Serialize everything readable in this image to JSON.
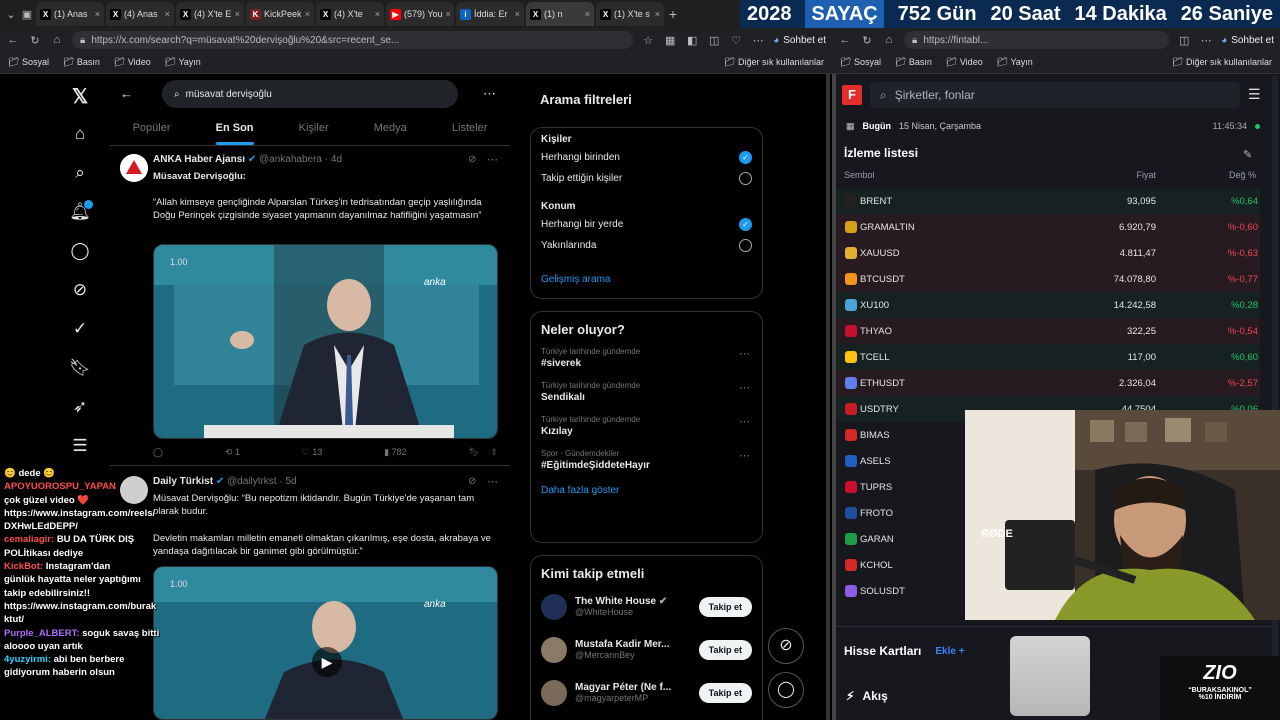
{
  "browser": {
    "tabs": [
      {
        "label": "(1) Anas",
        "fav": "X",
        "fav_color": "#000000"
      },
      {
        "label": "(4) Anas",
        "fav": "X",
        "fav_color": "#000000"
      },
      {
        "label": "(4) X'te E",
        "fav": "X",
        "fav_color": "#000000"
      },
      {
        "label": "KickPeek",
        "fav": "K",
        "fav_color": "#7a1f1f"
      },
      {
        "label": "(4) X'te",
        "fav": "X",
        "fav_color": "#000000"
      },
      {
        "label": "(579) You",
        "fav": "▶",
        "fav_color": "#ff0000"
      },
      {
        "label": "İddia: Er",
        "fav": "i",
        "fav_color": "#0a66c2"
      },
      {
        "label": "(1) n",
        "fav": "X",
        "fav_color": "#000000"
      },
      {
        "label": "(1) X'te s",
        "fav": "X",
        "fav_color": "#000000"
      }
    ],
    "left_url": "https://x.com/search?q=müsavat%20dervişoğlu%20&src=recent_se...",
    "right_url": "https://fintabl...",
    "chat_button": "Sohbet et",
    "bookmarks": [
      "Sosyal",
      "Basın",
      "Video",
      "Yayın"
    ],
    "bookmarks_other": "Diğer sık kullanılanlar"
  },
  "countdown": {
    "year": "2028",
    "word": "SAYAÇ",
    "days": "752 Gün",
    "hours": "20 Saat",
    "minutes": "14 Dakika",
    "seconds": "26 Saniye"
  },
  "x": {
    "search_value": "müsavat dervişoğlu",
    "tabs": [
      "Popüler",
      "En Son",
      "Kişiler",
      "Medya",
      "Listeler"
    ],
    "tweets": [
      {
        "name": "ANKA Haber Ajansı",
        "handle": "@ankahabera · 4d",
        "line1": "Müsavat Dervişoğlu:",
        "body": "“Allah kimseye gençliğinde Alparslan Türkeş'in tedrisatından geçip yaşlılığında Doğu Perinçek çizgisinde siyaset yapmanın dayanılmaz hafifliğini yaşatmasın”",
        "media_time": "1.00",
        "media_logo": "anka",
        "replies": "",
        "retweets": "1",
        "likes": "13",
        "views": "782"
      },
      {
        "name": "Daily Türkist",
        "handle": "@dailytrkst · 5d",
        "line1": "Müsavat Dervişoğlu: “Bu nepotizm iktidandır. Bugün Türkiye'de yaşanan tam olarak budur.",
        "body": "Devletin makamları milletin emaneti olmaktan çıkarılmış, eşe dosta, akrabaya ve yandaşa dağıtılacak bir ganimet gibi görülmüştür.”",
        "media_time": "1.00",
        "media_logo": "anka"
      }
    ],
    "filters": {
      "title": "Arama filtreleri",
      "people_label": "Kişiler",
      "people_opts": [
        "Herhangi birinden",
        "Takip ettiğin kişiler"
      ],
      "loc_label": "Konum",
      "loc_opts": [
        "Herhangi bir yerde",
        "Yakınlarında"
      ],
      "advanced": "Gelişmiş arama"
    },
    "trends": {
      "title": "Neler oluyor?",
      "items": [
        {
          "ctx": "Türkiye tarihinde gündemde",
          "tag": "#siverek"
        },
        {
          "ctx": "Türkiye tarihinde gündemde",
          "tag": "Sendikalı"
        },
        {
          "ctx": "Türkiye tarihinde gündemde",
          "tag": "Kızılay"
        },
        {
          "ctx": "Spor · Gündemdekiler",
          "tag": "#EğitimdeŞiddeteHayır"
        }
      ],
      "more": "Daha fazla göster"
    },
    "who": {
      "title": "Kimi takip etmeli",
      "items": [
        {
          "name": "The White House",
          "handle": "@WhiteHouse"
        },
        {
          "name": "Mustafa Kadir Mer...",
          "handle": "@MercannBey"
        },
        {
          "name": "Magyar Péter (Ne f...",
          "handle": "@magyarpeterMP"
        }
      ],
      "button": "Takip et"
    }
  },
  "chat": [
    {
      "user": "",
      "msg": "😊 dede 😊",
      "color": "#ffffff"
    },
    {
      "user": "APOYUOROSPU_YAPAN",
      "msg": "",
      "color": "#ff4d4d"
    },
    {
      "user": "",
      "msg": "çok güzel video ❤️",
      "color": "#ffffff"
    },
    {
      "user": "",
      "msg": "https://www.instagram.com/reels/",
      "color": "#ffffff"
    },
    {
      "user": "",
      "msg": "DXHwLEdDEPP/",
      "color": "#ffffff"
    },
    {
      "user": "cemaliagir:",
      "msg": "BU DA TÜRK DIŞ",
      "color": "#ff4d4d"
    },
    {
      "user": "",
      "msg": "POLİtikası dediye",
      "color": "#ffffff"
    },
    {
      "user": "KickBot:",
      "msg": "Instagram'dan",
      "color": "#ff4d4d"
    },
    {
      "user": "",
      "msg": "günlük hayatta neler yaptığımı",
      "color": "#ffffff"
    },
    {
      "user": "",
      "msg": "takip edebilirsiniz!!",
      "color": "#ffffff"
    },
    {
      "user": "",
      "msg": "https://www.instagram.com/burak",
      "color": "#ffffff"
    },
    {
      "user": "",
      "msg": "ktut/",
      "color": "#ffffff"
    },
    {
      "user": "Purple_ALBERT:",
      "msg": "soguk savaş bitti",
      "color": "#b06cff"
    },
    {
      "user": "",
      "msg": "aloooo uyan artık",
      "color": "#ffffff"
    },
    {
      "user": "4yuzyirmi:",
      "msg": "abi ben berbere",
      "color": "#2fd4ff"
    },
    {
      "user": "",
      "msg": "gidiyorum haberin olsun",
      "color": "#ffffff"
    }
  ],
  "fin": {
    "search_placeholder": "Şirketler, fonlar",
    "today": "Bugün",
    "date": "15 Nisan, Çarşamba",
    "time": "11:45:34",
    "watchlist": "İzleme listesi",
    "col_symbol": "Sembol",
    "col_price": "Fiyat",
    "col_change": "Değ %",
    "rows": [
      {
        "sym": "BRENT",
        "price": "93,095",
        "chg": "%0,64",
        "dir": "pos",
        "color": "#222222"
      },
      {
        "sym": "GRAMALTIN",
        "price": "6.920,79",
        "chg": "%-0,60",
        "dir": "neg",
        "color": "#d4a017"
      },
      {
        "sym": "XAUUSD",
        "price": "4.811,47",
        "chg": "%-0,63",
        "dir": "neg",
        "color": "#e0b030"
      },
      {
        "sym": "BTCUSDT",
        "price": "74.078,80",
        "chg": "%-0,77",
        "dir": "neg",
        "color": "#f7931a"
      },
      {
        "sym": "XU100",
        "price": "14.242,58",
        "chg": "%0,28",
        "dir": "pos",
        "color": "#4aa3d8"
      },
      {
        "sym": "THYAO",
        "price": "322,25",
        "chg": "%-0,54",
        "dir": "neg",
        "color": "#c8102e"
      },
      {
        "sym": "TCELL",
        "price": "117,00",
        "chg": "%0,60",
        "dir": "pos",
        "color": "#ffc20e"
      },
      {
        "sym": "ETHUSDT",
        "price": "2.326,04",
        "chg": "%-2,57",
        "dir": "neg",
        "color": "#627eea"
      },
      {
        "sym": "USDTRY",
        "price": "44,7504",
        "chg": "%0,06",
        "dir": "pos",
        "color": "#c81d25"
      },
      {
        "sym": "BIMAS",
        "price": "",
        "chg": "",
        "dir": "pos",
        "color": "#d62828"
      },
      {
        "sym": "ASELS",
        "price": "",
        "chg": "",
        "dir": "pos",
        "color": "#1f5fbf"
      },
      {
        "sym": "TUPRS",
        "price": "",
        "chg": "",
        "dir": "pos",
        "color": "#c8102e"
      },
      {
        "sym": "FROTO",
        "price": "",
        "chg": "",
        "dir": "pos",
        "color": "#1f4e9c"
      },
      {
        "sym": "GARAN",
        "price": "",
        "chg": "",
        "dir": "pos",
        "color": "#1e9e48"
      },
      {
        "sym": "KCHOL",
        "price": "",
        "chg": "",
        "dir": "pos",
        "color": "#d62828"
      },
      {
        "sym": "SOLUSDT",
        "price": "",
        "chg": "",
        "dir": "pos",
        "color": "#8f5ce6"
      }
    ],
    "cards": "Hisse Kartları",
    "cards_add": "Ekle",
    "flow": "Akış"
  },
  "overlay": {
    "mic_brand": "RØDE",
    "promo_logo": "ZIO",
    "promo_code": "“BURAKSAKINOL”",
    "promo_discount": "%10 İNDİRİM"
  }
}
